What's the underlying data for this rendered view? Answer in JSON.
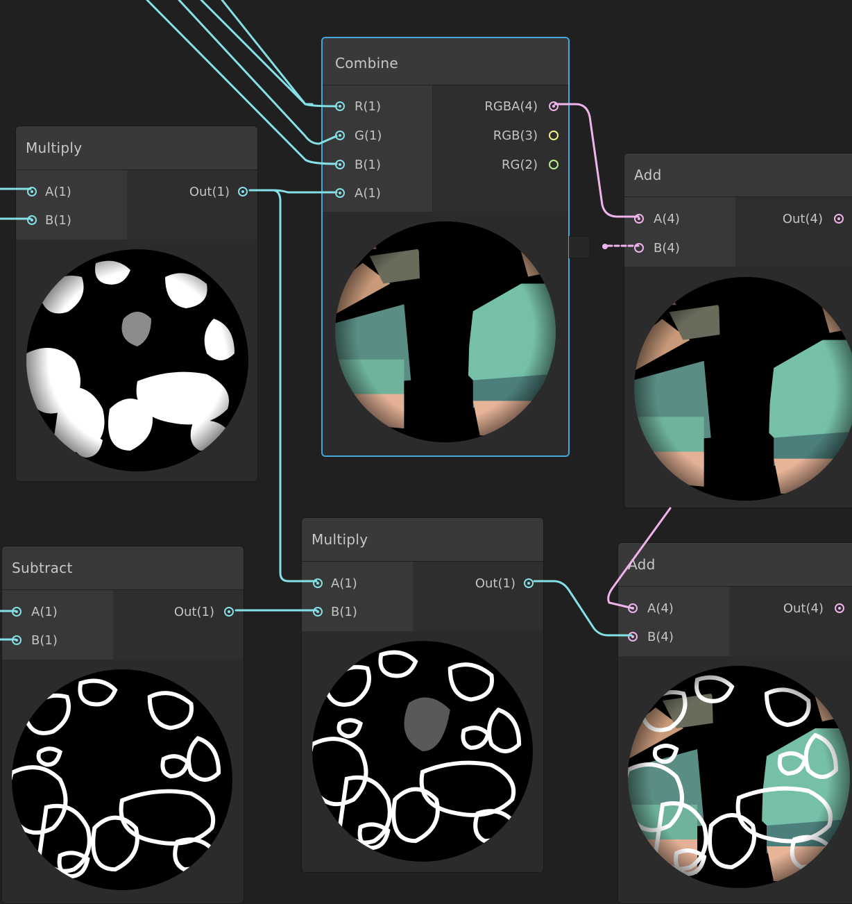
{
  "colors": {
    "background": "#202020",
    "node_body": "#2b2b2b",
    "node_header": "#393939",
    "selection": "#44a8e0",
    "wire_float": "#86e0e8",
    "wire_vector4": "#f0b4ec",
    "port_vector3": "#f4f08c",
    "port_vector2": "#b6f08e"
  },
  "nodes": {
    "combine": {
      "title": "Combine",
      "selected": true,
      "inputs": [
        "R(1)",
        "G(1)",
        "B(1)",
        "A(1)"
      ],
      "outputs": [
        "RGBA(4)",
        "RGB(3)",
        "RG(2)"
      ],
      "preview": "colored-sphere-preview"
    },
    "multiply_top": {
      "title": "Multiply",
      "inputs": [
        "A(1)",
        "B(1)"
      ],
      "outputs": [
        "Out(1)"
      ],
      "preview": "mask-sphere-preview"
    },
    "add_top": {
      "title": "Add",
      "inputs": [
        "A(4)",
        "B(4)"
      ],
      "outputs": [
        "Out(4)"
      ],
      "preview": "colored-sphere-preview"
    },
    "subtract": {
      "title": "Subtract",
      "inputs": [
        "A(1)",
        "B(1)"
      ],
      "outputs": [
        "Out(1)"
      ],
      "preview": "outline-mask-sphere-preview"
    },
    "multiply_bottom": {
      "title": "Multiply",
      "inputs": [
        "A(1)",
        "B(1)"
      ],
      "outputs": [
        "Out(1)"
      ],
      "preview": "outline-mask-sphere-preview"
    },
    "add_bottom": {
      "title": "Add",
      "inputs": [
        "A(4)",
        "B(4)"
      ],
      "outputs": [
        "Out(4)"
      ],
      "preview": "outlined-colored-sphere-preview"
    }
  }
}
